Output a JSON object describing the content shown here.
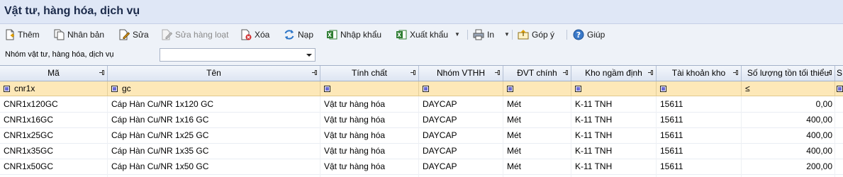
{
  "title": "Vật tư, hàng hóa, dịch vụ",
  "toolbar": {
    "add": "Thêm",
    "duplicate": "Nhân bản",
    "edit": "Sửa",
    "bulk_edit": "Sửa hàng loạt",
    "delete": "Xóa",
    "reload": "Nạp",
    "import": "Nhập khẩu",
    "export": "Xuất khẩu",
    "print": "In",
    "feedback": "Góp ý",
    "help": "Giúp"
  },
  "filter": {
    "label": "Nhóm vật tư, hàng hóa, dịch vụ",
    "value": ""
  },
  "columns": [
    "Mã",
    "Tên",
    "Tính chất",
    "Nhóm VTHH",
    "ĐVT chính",
    "Kho ngầm định",
    "Tài khoản kho",
    "Số lượng tồn tối thiểu",
    "S"
  ],
  "filter_row": {
    "code": "cnr1x",
    "name": "gc",
    "min_qty_op": "≤"
  },
  "rows": [
    {
      "code": "CNR1x120GC",
      "name": "Cáp Hàn Cu/NR 1x120 GC",
      "nature": "Vật tư hàng hóa",
      "group": "DAYCAP",
      "unit": "Mét",
      "warehouse": "K-11 TNH",
      "account": "15611",
      "min_qty": "0,00"
    },
    {
      "code": "CNR1x16GC",
      "name": "Cáp Hàn Cu/NR 1x16 GC",
      "nature": "Vật tư hàng hóa",
      "group": "DAYCAP",
      "unit": "Mét",
      "warehouse": "K-11 TNH",
      "account": "15611",
      "min_qty": "400,00"
    },
    {
      "code": "CNR1x25GC",
      "name": "Cáp Hàn Cu/NR 1x25 GC",
      "nature": "Vật tư hàng hóa",
      "group": "DAYCAP",
      "unit": "Mét",
      "warehouse": "K-11 TNH",
      "account": "15611",
      "min_qty": "400,00"
    },
    {
      "code": "CNR1x35GC",
      "name": "Cáp Hàn Cu/NR 1x35 GC",
      "nature": "Vật tư hàng hóa",
      "group": "DAYCAP",
      "unit": "Mét",
      "warehouse": "K-11 TNH",
      "account": "15611",
      "min_qty": "400,00"
    },
    {
      "code": "CNR1x50GC",
      "name": "Cáp Hàn Cu/NR 1x50 GC",
      "nature": "Vật tư hàng hóa",
      "group": "DAYCAP",
      "unit": "Mét",
      "warehouse": "K-11 TNH",
      "account": "15611",
      "min_qty": "200,00"
    }
  ]
}
